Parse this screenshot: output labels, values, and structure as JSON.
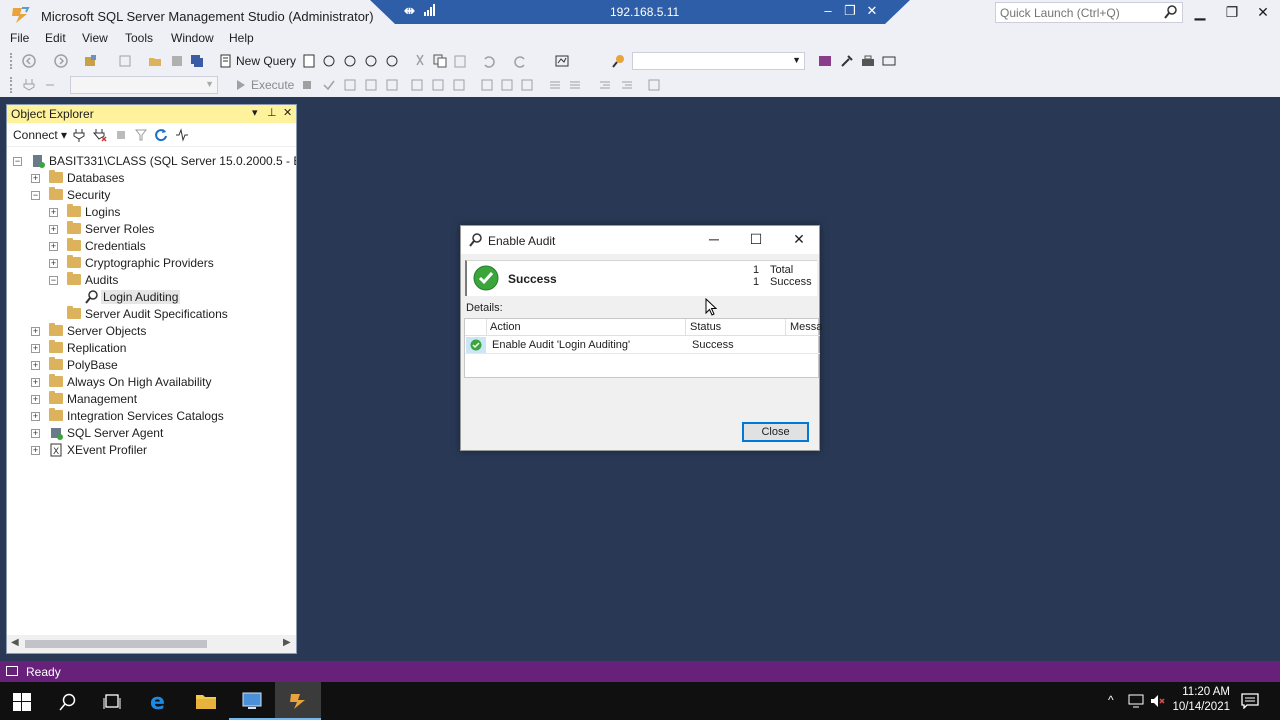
{
  "window": {
    "title": "Microsoft SQL Server Management Studio (Administrator)",
    "remote_ip": "192.168.5.11",
    "quick_launch_placeholder": "Quick Launch (Ctrl+Q)"
  },
  "menu": [
    "File",
    "Edit",
    "View",
    "Tools",
    "Window",
    "Help"
  ],
  "toolbar": {
    "new_query_label": "New Query",
    "execute_label": "Execute"
  },
  "object_explorer": {
    "title": "Object Explorer",
    "connect_label": "Connect",
    "server_node": "BASIT331\\CLASS (SQL Server 15.0.2000.5 - BASIT331\\",
    "nodes": [
      {
        "label": "Databases"
      },
      {
        "label": "Security"
      },
      {
        "label": "Logins"
      },
      {
        "label": "Server Roles"
      },
      {
        "label": "Credentials"
      },
      {
        "label": "Cryptographic Providers"
      },
      {
        "label": "Audits"
      },
      {
        "label": "Login Auditing"
      },
      {
        "label": "Server Audit Specifications"
      },
      {
        "label": "Server Objects"
      },
      {
        "label": "Replication"
      },
      {
        "label": "PolyBase"
      },
      {
        "label": "Always On High Availability"
      },
      {
        "label": "Management"
      },
      {
        "label": "Integration Services Catalogs"
      },
      {
        "label": "SQL Server Agent"
      },
      {
        "label": "XEvent Profiler"
      }
    ]
  },
  "dialog": {
    "title": "Enable Audit",
    "status": "Success",
    "total_count": "1",
    "total_label": "Total",
    "success_count": "1",
    "success_label": "Success",
    "details_label": "Details:",
    "columns": [
      "Action",
      "Status",
      "Messa"
    ],
    "rows": [
      {
        "action": "Enable Audit 'Login Auditing'",
        "status": "Success",
        "message": ""
      }
    ],
    "close_label": "Close"
  },
  "statusbar": {
    "text": "Ready"
  },
  "taskbar": {
    "time": "11:20 AM",
    "date": "10/14/2021"
  },
  "colors": {
    "workspace": "#293955",
    "status_bar": "#68217a",
    "explorer_header": "#fff29d",
    "success_green": "#3aa53a",
    "accent_blue": "#0078d7"
  }
}
